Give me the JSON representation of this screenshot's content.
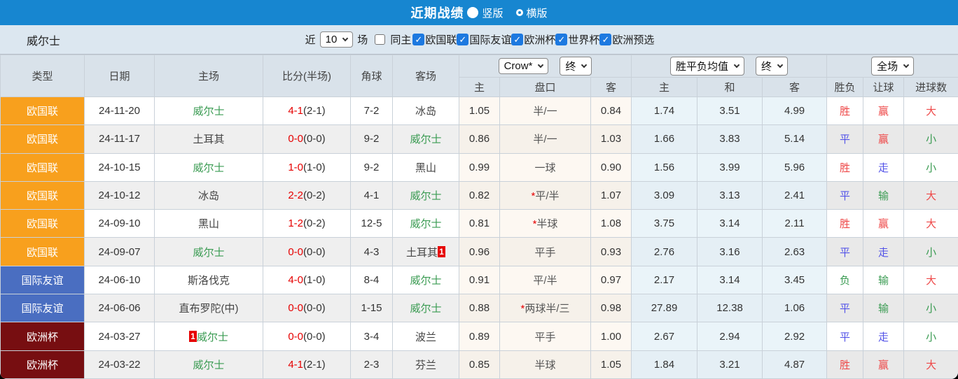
{
  "title_bar": {
    "title": "近期战绩",
    "options": [
      {
        "label": "竖版",
        "selected": true
      },
      {
        "label": "横版",
        "selected": false
      }
    ]
  },
  "filter_bar": {
    "team": "威尔士",
    "near": "近",
    "count": "10",
    "unit": "场",
    "same_home": {
      "label": "同主",
      "checked": false
    },
    "competitions": [
      {
        "label": "欧国联",
        "checked": true
      },
      {
        "label": "国际友谊",
        "checked": true
      },
      {
        "label": "欧洲杯",
        "checked": true
      },
      {
        "label": "世界杯",
        "checked": true
      },
      {
        "label": "欧洲预选",
        "checked": true
      }
    ]
  },
  "table": {
    "selectors": {
      "odds_source": "Crow*",
      "odds_time": "终",
      "mean_source": "胜平负均值",
      "mean_time": "终",
      "scope": "全场"
    },
    "left_columns": [
      "类型",
      "日期",
      "主场",
      "比分(半场)",
      "角球",
      "客场"
    ],
    "sub_columns": [
      "主",
      "盘口",
      "客",
      "主",
      "和",
      "客",
      "胜负",
      "让球",
      "进球数"
    ],
    "type_colors": {
      "欧国联": "#f8a01d",
      "国际友谊": "#4a6ec1",
      "欧洲杯": "#770e11"
    },
    "result_colors": {
      "胜": "red",
      "平": "blue",
      "负": "green",
      "赢": "red",
      "走": "blue",
      "输": "green",
      "大": "red",
      "小": "green"
    },
    "wales_name": "威尔士",
    "rows": [
      {
        "type": "欧国联",
        "date": "24-11-20",
        "home": "威尔士",
        "home_badge": "",
        "score": "4-1",
        "half": "(2-1)",
        "corners": "7-2",
        "away": "冰岛",
        "away_badge": "",
        "odds": [
          "1.05",
          "半/一",
          "0.84"
        ],
        "mean": [
          "1.74",
          "3.51",
          "4.99"
        ],
        "results": [
          "胜",
          "赢",
          "大"
        ]
      },
      {
        "type": "欧国联",
        "date": "24-11-17",
        "home": "土耳其",
        "home_badge": "",
        "score": "0-0",
        "half": "(0-0)",
        "corners": "9-2",
        "away": "威尔士",
        "away_badge": "",
        "odds": [
          "0.86",
          "半/一",
          "1.03"
        ],
        "mean": [
          "1.66",
          "3.83",
          "5.14"
        ],
        "results": [
          "平",
          "赢",
          "小"
        ]
      },
      {
        "type": "欧国联",
        "date": "24-10-15",
        "home": "威尔士",
        "home_badge": "",
        "score": "1-0",
        "half": "(1-0)",
        "corners": "9-2",
        "away": "黑山",
        "away_badge": "",
        "odds": [
          "0.99",
          "一球",
          "0.90"
        ],
        "mean": [
          "1.56",
          "3.99",
          "5.96"
        ],
        "results": [
          "胜",
          "走",
          "小"
        ]
      },
      {
        "type": "欧国联",
        "date": "24-10-12",
        "home": "冰岛",
        "home_badge": "",
        "score": "2-2",
        "half": "(0-2)",
        "corners": "4-1",
        "away": "威尔士",
        "away_badge": "",
        "odds": [
          "0.82",
          "*平/半",
          "1.07"
        ],
        "mean": [
          "3.09",
          "3.13",
          "2.41"
        ],
        "results": [
          "平",
          "输",
          "大"
        ]
      },
      {
        "type": "欧国联",
        "date": "24-09-10",
        "home": "黑山",
        "home_badge": "",
        "score": "1-2",
        "half": "(0-2)",
        "corners": "12-5",
        "away": "威尔士",
        "away_badge": "",
        "odds": [
          "0.81",
          "*半球",
          "1.08"
        ],
        "mean": [
          "3.75",
          "3.14",
          "2.11"
        ],
        "results": [
          "胜",
          "赢",
          "大"
        ]
      },
      {
        "type": "欧国联",
        "date": "24-09-07",
        "home": "威尔士",
        "home_badge": "",
        "score": "0-0",
        "half": "(0-0)",
        "corners": "4-3",
        "away": "土耳其",
        "away_badge": "1",
        "odds": [
          "0.96",
          "平手",
          "0.93"
        ],
        "mean": [
          "2.76",
          "3.16",
          "2.63"
        ],
        "results": [
          "平",
          "走",
          "小"
        ]
      },
      {
        "type": "国际友谊",
        "date": "24-06-10",
        "home": "斯洛伐克",
        "home_badge": "",
        "score": "4-0",
        "half": "(1-0)",
        "corners": "8-4",
        "away": "威尔士",
        "away_badge": "",
        "odds": [
          "0.91",
          "平/半",
          "0.97"
        ],
        "mean": [
          "2.17",
          "3.14",
          "3.45"
        ],
        "results": [
          "负",
          "输",
          "大"
        ]
      },
      {
        "type": "国际友谊",
        "date": "24-06-06",
        "home": "直布罗陀(中)",
        "home_badge": "",
        "score": "0-0",
        "half": "(0-0)",
        "corners": "1-15",
        "away": "威尔士",
        "away_badge": "",
        "odds": [
          "0.88",
          "*两球半/三",
          "0.98"
        ],
        "mean": [
          "27.89",
          "12.38",
          "1.06"
        ],
        "results": [
          "平",
          "输",
          "小"
        ]
      },
      {
        "type": "欧洲杯",
        "date": "24-03-27",
        "home": "威尔士",
        "home_badge": "1",
        "score": "0-0",
        "half": "(0-0)",
        "corners": "3-4",
        "away": "波兰",
        "away_badge": "",
        "odds": [
          "0.89",
          "平手",
          "1.00"
        ],
        "mean": [
          "2.67",
          "2.94",
          "2.92"
        ],
        "results": [
          "平",
          "走",
          "小"
        ]
      },
      {
        "type": "欧洲杯",
        "date": "24-03-22",
        "home": "威尔士",
        "home_badge": "",
        "score": "4-1",
        "half": "(2-1)",
        "corners": "2-3",
        "away": "芬兰",
        "away_badge": "",
        "odds": [
          "0.85",
          "半球",
          "1.05"
        ],
        "mean": [
          "1.84",
          "3.21",
          "4.87"
        ],
        "results": [
          "胜",
          "赢",
          "大"
        ]
      }
    ]
  }
}
